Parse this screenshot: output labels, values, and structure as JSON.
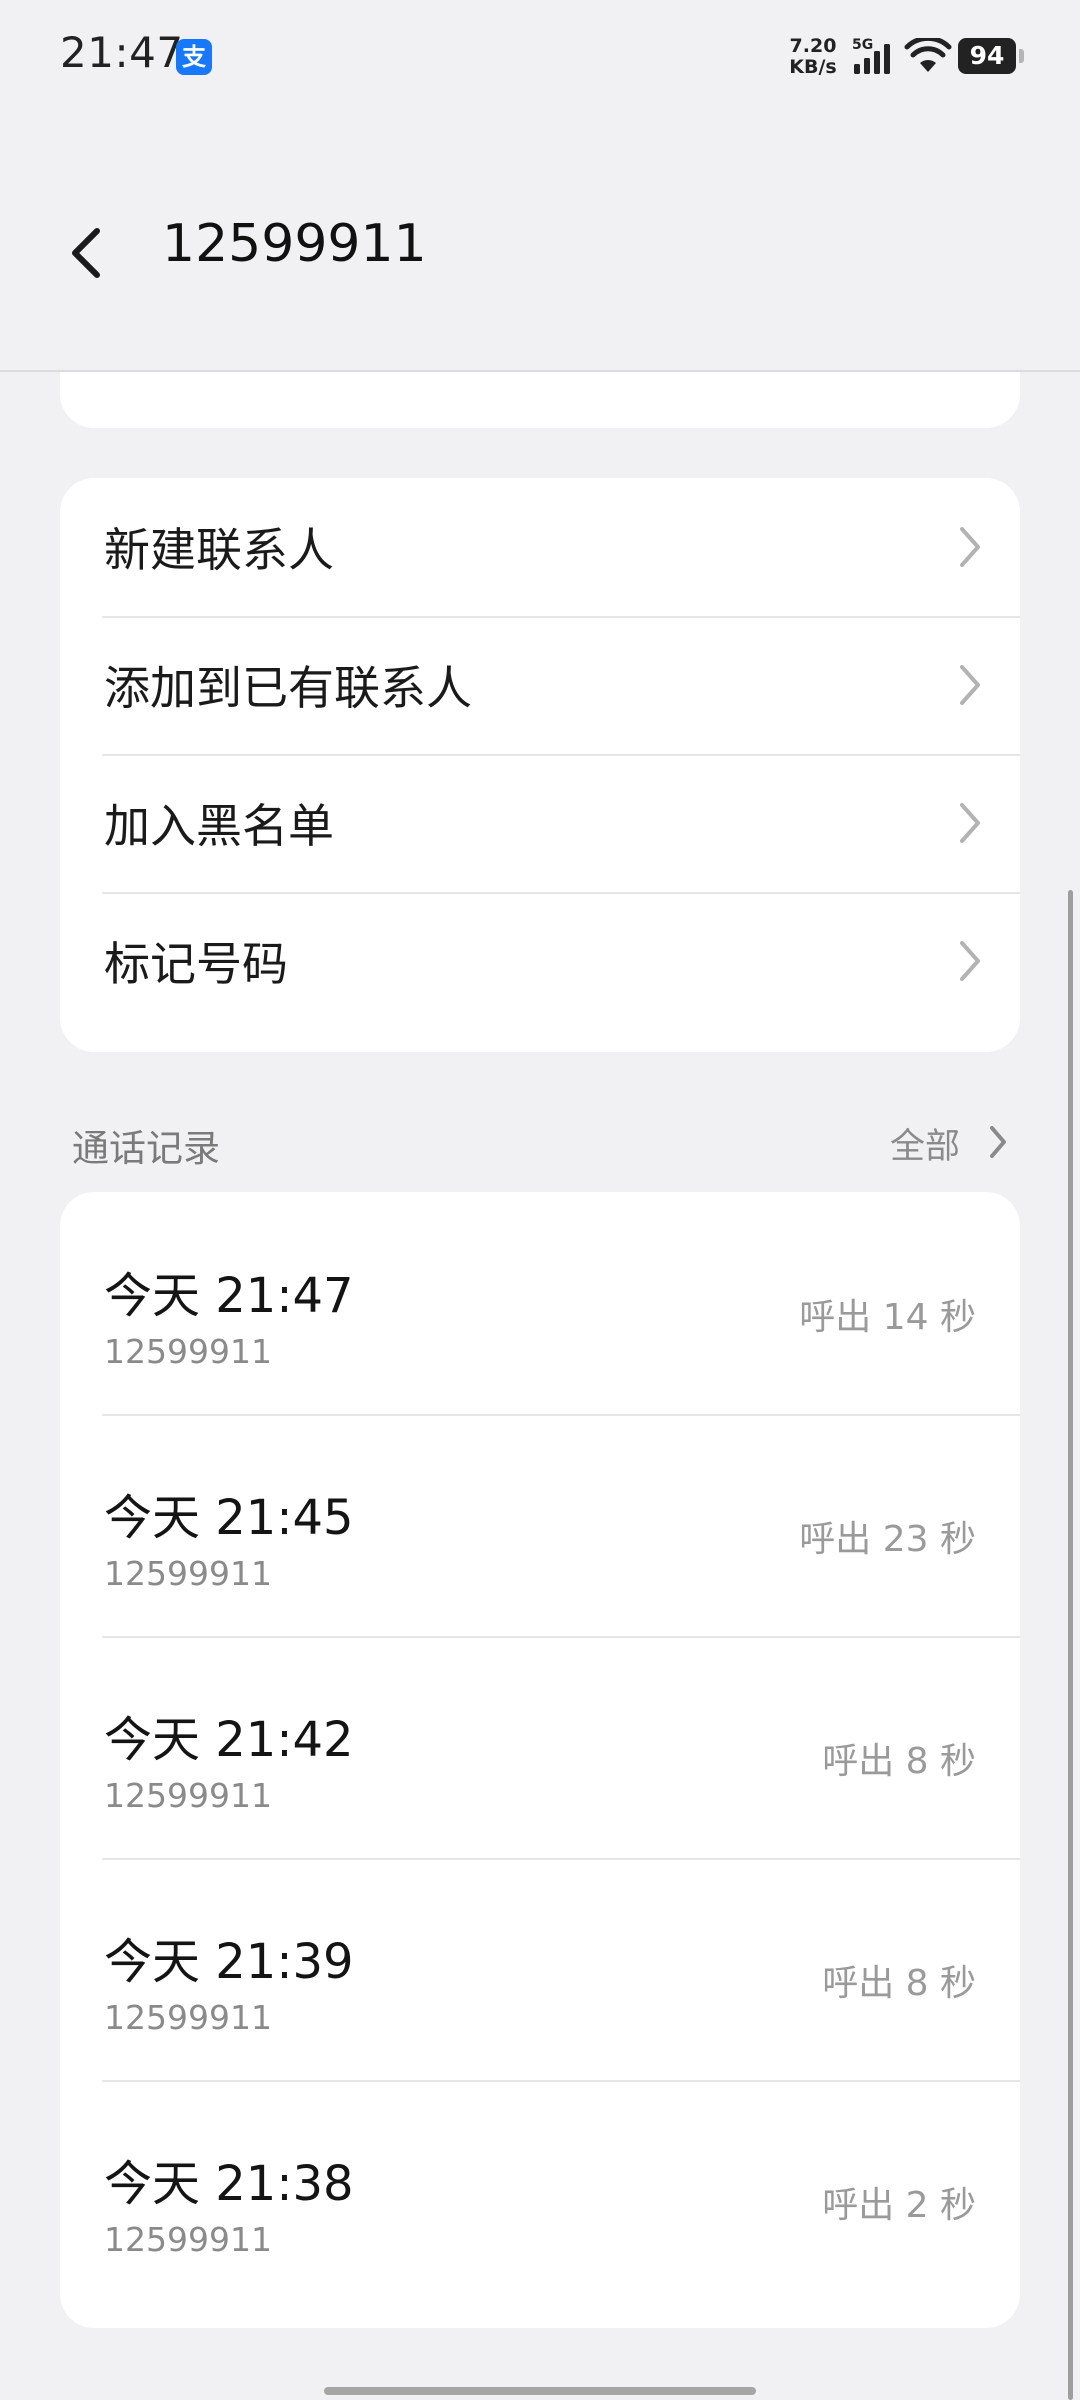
{
  "status_bar": {
    "time": "21:47",
    "app_icon_glyph": "支",
    "speed_value": "7.20",
    "speed_unit": "KB/s",
    "network_type": "5G",
    "battery_level": "94"
  },
  "header": {
    "title": "12599911"
  },
  "actions": [
    {
      "label": "新建联系人"
    },
    {
      "label": "添加到已有联系人"
    },
    {
      "label": "加入黑名单"
    },
    {
      "label": "标记号码"
    }
  ],
  "call_log": {
    "title": "通话记录",
    "all_label": "全部",
    "items": [
      {
        "time": "今天 21:47",
        "number": "12599911",
        "status": "呼出 14 秒"
      },
      {
        "time": "今天 21:45",
        "number": "12599911",
        "status": "呼出 23 秒"
      },
      {
        "time": "今天 21:42",
        "number": "12599911",
        "status": "呼出 8 秒"
      },
      {
        "time": "今天 21:39",
        "number": "12599911",
        "status": "呼出 8 秒"
      },
      {
        "time": "今天 21:38",
        "number": "12599911",
        "status": "呼出 2 秒"
      }
    ]
  },
  "colors": {
    "background": "#f1f1f3",
    "card": "#ffffff",
    "alipay_blue": "#1677ff"
  }
}
